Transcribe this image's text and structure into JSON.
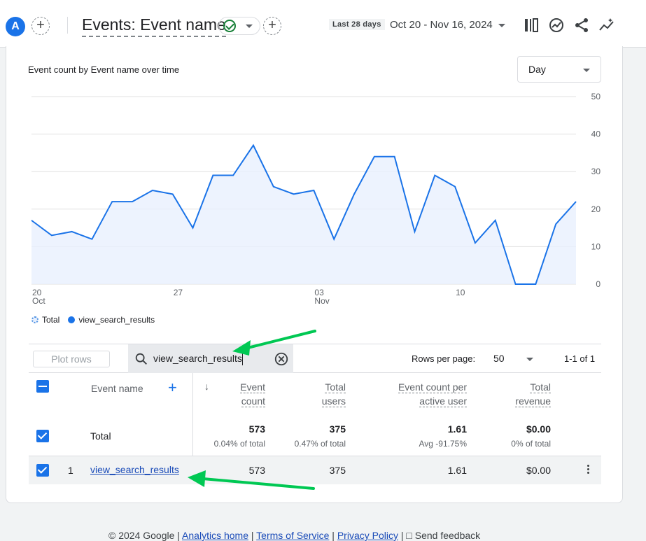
{
  "header": {
    "avatar_letter": "A",
    "title": "Events: Event name",
    "date_range_label": "Last 28 days",
    "date_range_value": "Oct 20 - Nov 16, 2024"
  },
  "card": {
    "chart_title": "Event count by Event name over time",
    "granularity": "Day"
  },
  "chart_data": {
    "type": "area",
    "title": "Event count by Event name over time",
    "x_tick_labels": [
      "20",
      "Oct",
      "27",
      "03",
      "Nov",
      "10"
    ],
    "y_tick_labels": [
      "50",
      "40",
      "30",
      "20",
      "10",
      "0"
    ],
    "ylim": [
      0,
      50
    ],
    "grid": true,
    "legend_position": "bottom-left",
    "x": [
      "Oct 20",
      "Oct 21",
      "Oct 22",
      "Oct 23",
      "Oct 24",
      "Oct 25",
      "Oct 26",
      "Oct 27",
      "Oct 28",
      "Oct 29",
      "Oct 30",
      "Oct 31",
      "Nov 1",
      "Nov 2",
      "Nov 3",
      "Nov 4",
      "Nov 5",
      "Nov 6",
      "Nov 7",
      "Nov 8",
      "Nov 9",
      "Nov 10",
      "Nov 11",
      "Nov 12",
      "Nov 13",
      "Nov 14",
      "Nov 15",
      "Nov 16"
    ],
    "series": [
      {
        "name": "view_search_results",
        "color": "#1a73e8",
        "values": [
          17,
          13,
          14,
          12,
          22,
          22,
          25,
          24,
          15,
          29,
          29,
          37,
          26,
          24,
          25,
          12,
          24,
          34,
          34,
          14,
          29,
          26,
          11,
          17,
          0,
          0,
          16,
          22
        ]
      }
    ],
    "legend": [
      "Total",
      "view_search_results"
    ]
  },
  "table": {
    "plot_rows_label": "Plot rows",
    "search_value": "view_search_results",
    "rows_per_page_label": "Rows per page:",
    "rows_per_page_value": "50",
    "pager_text": "1-1 of 1",
    "columns": {
      "event_name": "Event name",
      "event_count_1": "Event",
      "event_count_2": "count",
      "total_users_1": "Total",
      "total_users_2": "users",
      "ecpau_1": "Event count per",
      "ecpau_2": "active user",
      "revenue_1": "Total",
      "revenue_2": "revenue"
    },
    "total_row": {
      "label": "Total",
      "event_count": "573",
      "event_count_sub": "0.04% of total",
      "total_users": "375",
      "total_users_sub": "0.47% of total",
      "ecpau": "1.61",
      "ecpau_sub": "Avg -91.75%",
      "revenue": "$0.00",
      "revenue_sub": "0% of total"
    },
    "rows": [
      {
        "index": "1",
        "name": "view_search_results",
        "event_count": "573",
        "total_users": "375",
        "ecpau": "1.61",
        "revenue": "$0.00"
      }
    ]
  },
  "footer": {
    "copyright": "© 2024 Google |",
    "analytics_home": "Analytics home",
    "sep1": "|",
    "terms": "Terms of Service",
    "sep2": "|",
    "privacy": "Privacy Policy",
    "sep3": "|",
    "feedback": "Send feedback"
  },
  "colors": {
    "accent": "#1a73e8",
    "annotation_arrow": "#00c853"
  }
}
